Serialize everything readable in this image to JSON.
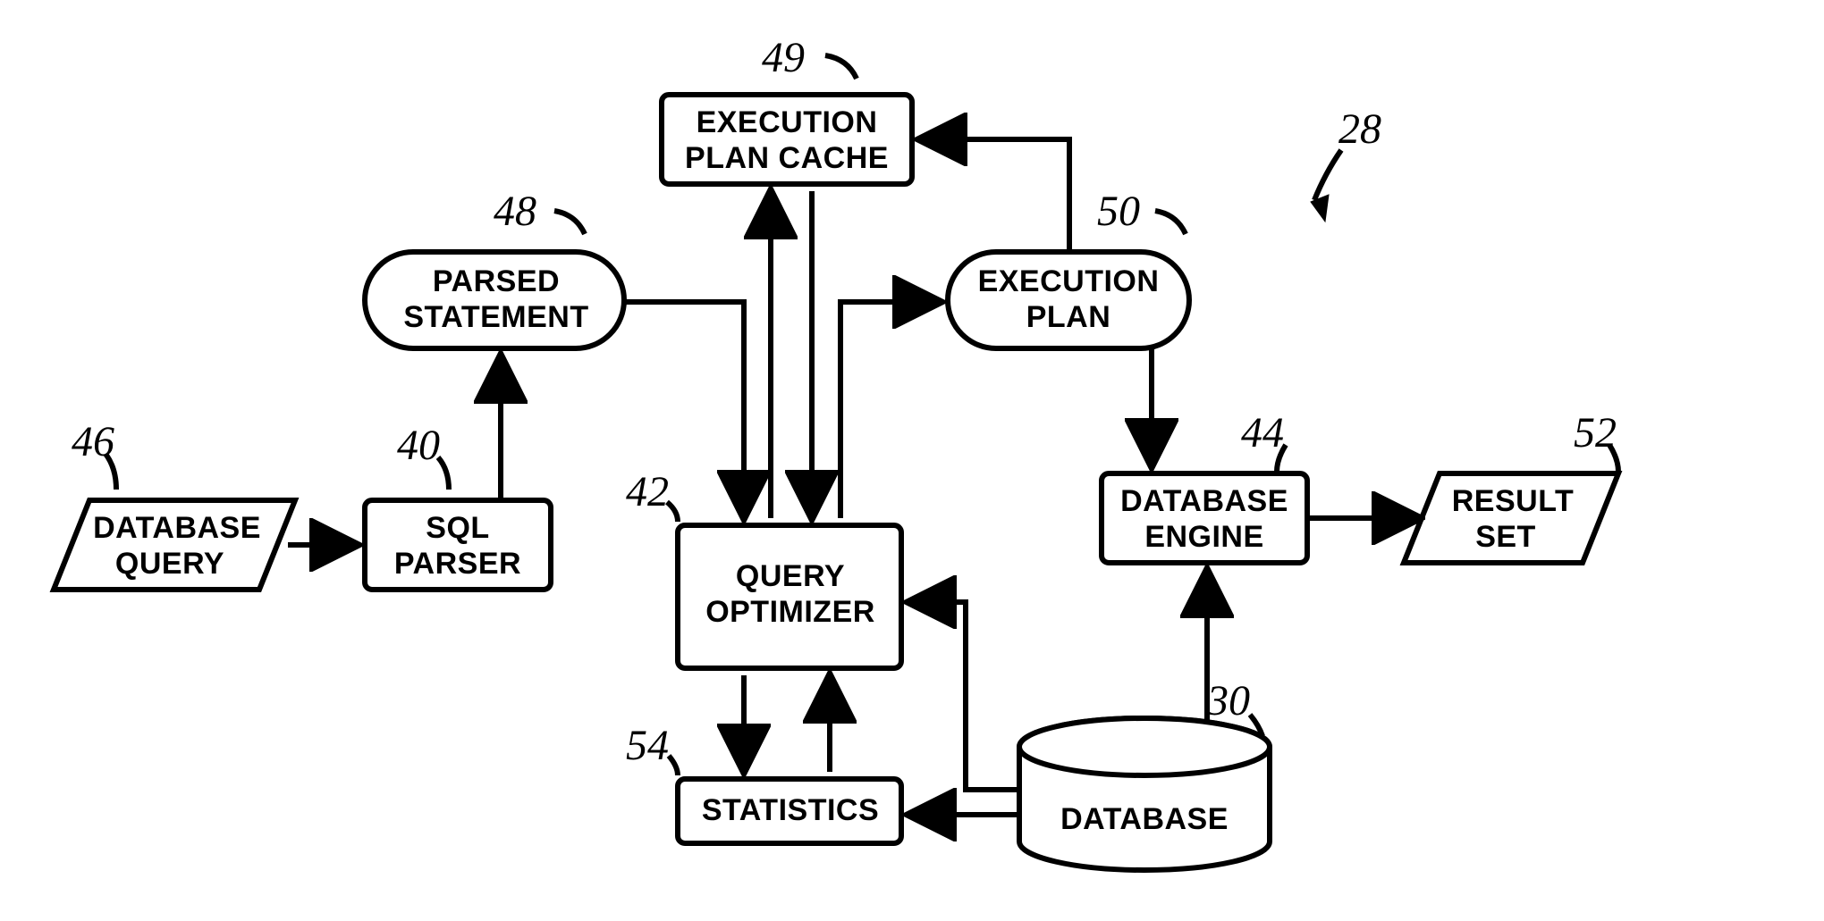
{
  "nodes": {
    "databaseQuery": {
      "ref": "46",
      "line1": "DATABASE",
      "line2": "QUERY"
    },
    "sqlParser": {
      "ref": "40",
      "line1": "SQL",
      "line2": "PARSER"
    },
    "parsedStatement": {
      "ref": "48",
      "line1": "PARSED",
      "line2": "STATEMENT"
    },
    "execPlanCache": {
      "ref": "49",
      "line1": "EXECUTION",
      "line2": "PLAN CACHE"
    },
    "executionPlan": {
      "ref": "50",
      "line1": "EXECUTION",
      "line2": "PLAN"
    },
    "diagramRef": {
      "ref": "28"
    },
    "queryOptimizer": {
      "ref": "42",
      "line1": "QUERY",
      "line2": "OPTIMIZER"
    },
    "dbEngine": {
      "ref": "44",
      "line1": "DATABASE",
      "line2": "ENGINE"
    },
    "resultSet": {
      "ref": "52",
      "line1": "RESULT",
      "line2": "SET"
    },
    "statistics": {
      "ref": "54",
      "line1": "STATISTICS"
    },
    "database": {
      "ref": "30",
      "line1": "DATABASE"
    }
  }
}
